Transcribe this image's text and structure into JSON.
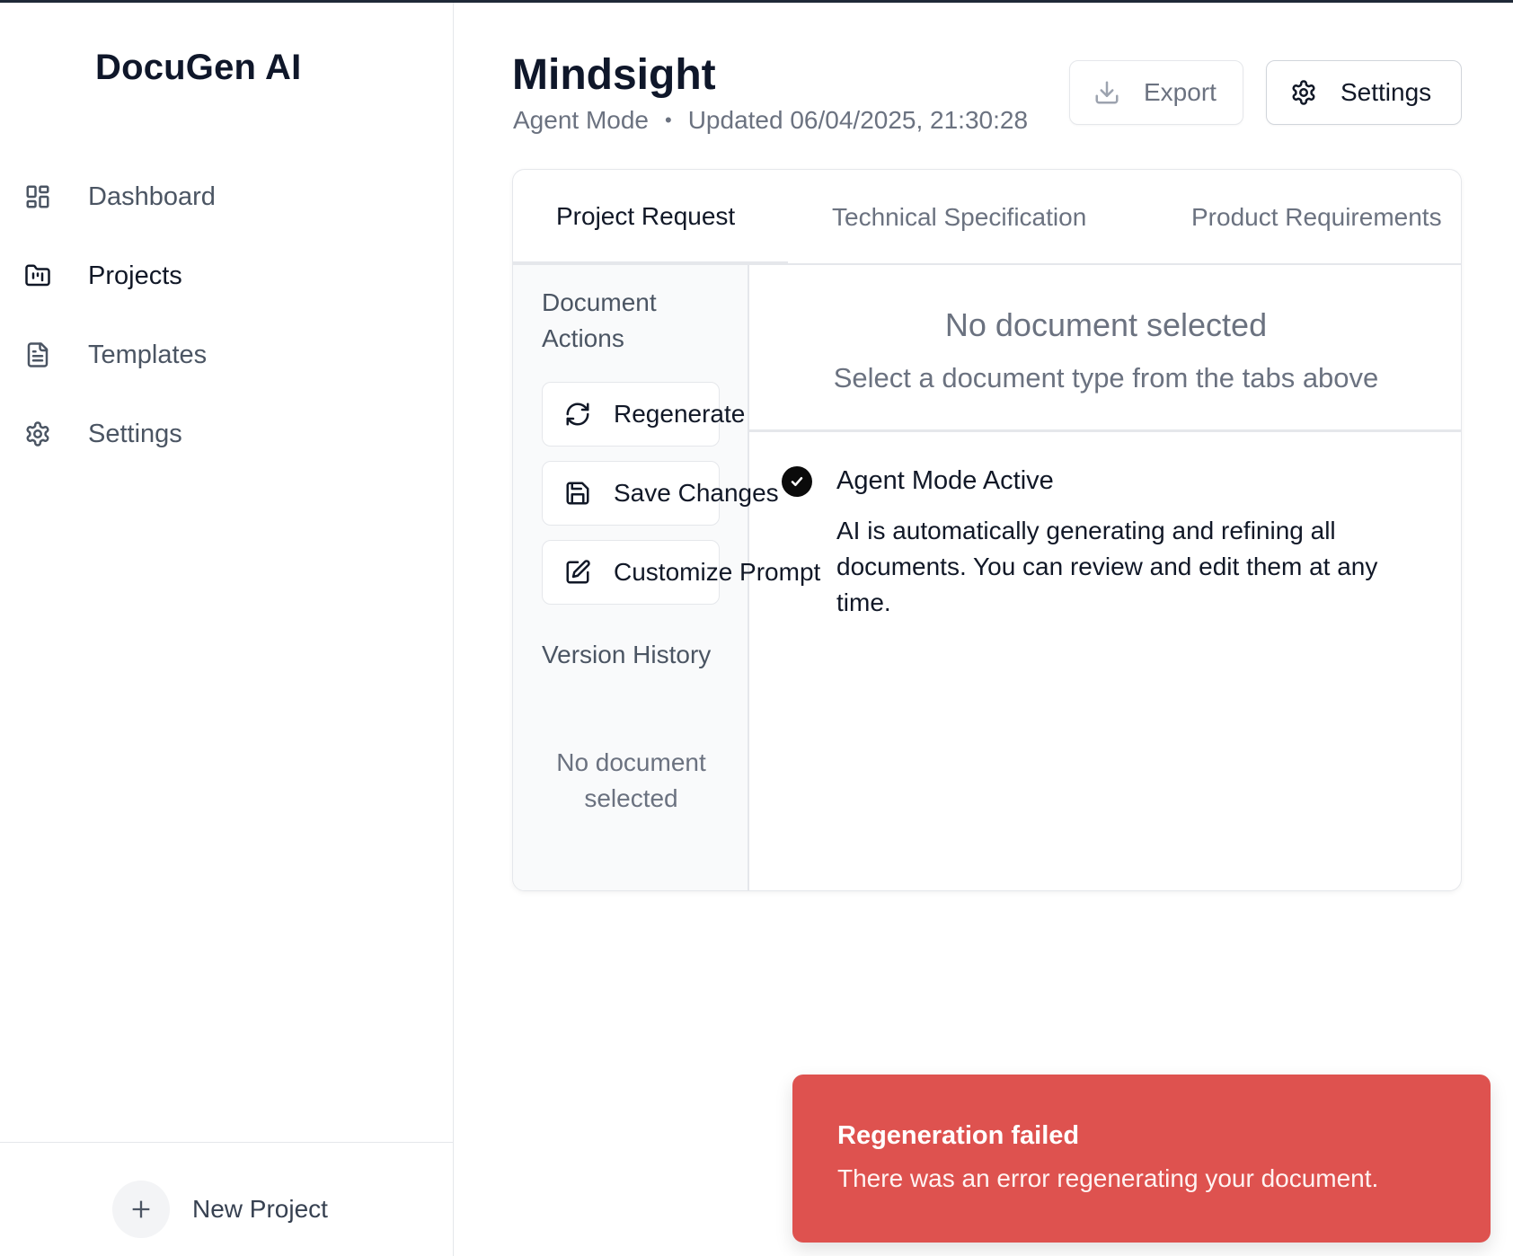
{
  "app": {
    "name": "DocuGen AI"
  },
  "sidebar": {
    "items": [
      {
        "label": "Dashboard",
        "icon": "dashboard-icon",
        "active": false
      },
      {
        "label": "Projects",
        "icon": "folder-icon",
        "active": true
      },
      {
        "label": "Templates",
        "icon": "document-icon",
        "active": false
      },
      {
        "label": "Settings",
        "icon": "gear-icon",
        "active": false
      }
    ],
    "new_project_label": "New Project"
  },
  "header": {
    "title": "Mindsight",
    "mode": "Agent Mode",
    "separator": "•",
    "updated": "Updated 06/04/2025, 21:30:28",
    "export_label": "Export",
    "settings_label": "Settings"
  },
  "tabs": [
    {
      "label": "Project Request",
      "active": true
    },
    {
      "label": "Technical Specification",
      "active": false
    },
    {
      "label": "Product Requirements",
      "active": false
    }
  ],
  "left_panel": {
    "actions_heading": "Document Actions",
    "actions": [
      {
        "label": "Regenerate",
        "icon": "refresh-icon"
      },
      {
        "label": "Save Changes",
        "icon": "save-icon"
      },
      {
        "label": "Customize Prompt",
        "icon": "edit-icon"
      }
    ],
    "history_heading": "Version History",
    "history_empty": "No document selected"
  },
  "content": {
    "empty_title": "No document selected",
    "empty_subtitle": "Select a document type from the tabs above",
    "agent_title": "Agent Mode Active",
    "agent_body": "AI is automatically generating and refining all documents. You can review and edit them at any time."
  },
  "toast": {
    "title": "Regeneration failed",
    "message": "There was an error regenerating your document.",
    "color": "#de524f"
  }
}
